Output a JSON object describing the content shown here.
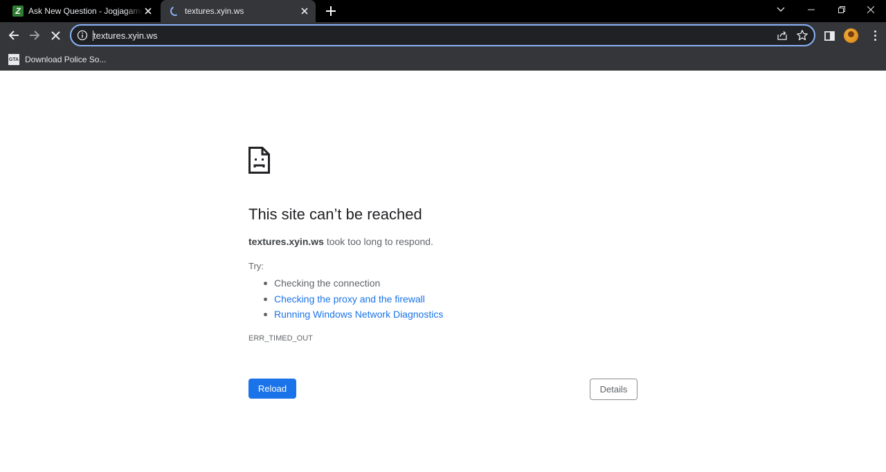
{
  "browser": {
    "tabs": [
      {
        "title": "Ask New Question - Jogjagamers",
        "favicon": "jogjagamers-icon",
        "active": false
      },
      {
        "title": "textures.xyin.ws",
        "favicon": "loading-spinner-icon",
        "active": true
      }
    ],
    "omnibox": {
      "url": "textures.xyin.ws"
    },
    "bookmarks": [
      {
        "label": "Download Police So..."
      }
    ]
  },
  "error_page": {
    "icon": "sad-document-icon",
    "heading": "This site can’t be reached",
    "host": "textures.xyin.ws",
    "summary_rest": " took too long to respond.",
    "try_label": "Try:",
    "suggestions": [
      {
        "text": "Checking the connection",
        "link": false
      },
      {
        "text": "Checking the proxy and the firewall",
        "link": true
      },
      {
        "text": "Running Windows Network Diagnostics",
        "link": true
      }
    ],
    "error_code": "ERR_TIMED_OUT",
    "reload_label": "Reload",
    "details_label": "Details"
  },
  "colors": {
    "accent": "#1a73e8",
    "omnibox_focus": "#8ab4f8",
    "chrome_dark": "#35363a",
    "tabstrip": "#000000"
  }
}
